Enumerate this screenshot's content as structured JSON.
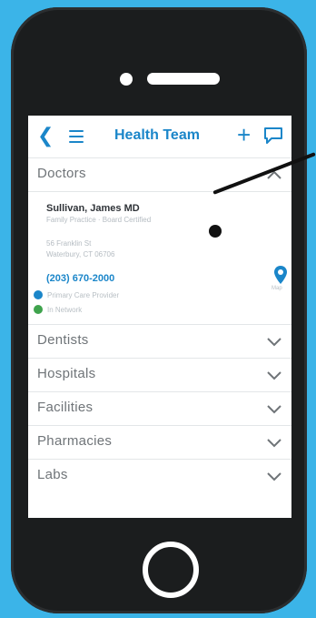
{
  "header": {
    "back_icon": "chevron-left-icon",
    "menu_icon": "hamburger-menu-icon",
    "title": "Health Team",
    "add_icon": "plus-icon",
    "chat_icon": "chat-bubble-icon"
  },
  "sections": {
    "doctors": {
      "label": "Doctors",
      "state": "expanded"
    },
    "dentists": {
      "label": "Dentists"
    },
    "hospitals": {
      "label": "Hospitals"
    },
    "facilities": {
      "label": "Facilities"
    },
    "pharmacies": {
      "label": "Pharmacies"
    },
    "labs": {
      "label": "Labs"
    }
  },
  "doctor": {
    "name": "Sullivan, James MD",
    "specialty": "Family Practice · Board Certified",
    "address_line1": "56 Franklin St",
    "address_line2": "Waterbury, CT 06706",
    "phone": "(203) 670-2000",
    "badges": [
      {
        "text": "Primary Care Provider",
        "color": "#1b86c9"
      },
      {
        "text": "In Network",
        "color": "#3fa34d"
      }
    ],
    "map_label": "Map"
  },
  "colors": {
    "accent": "#1b86c9",
    "background": "#3bb4e8",
    "phone_body": "#1b1d1e"
  }
}
